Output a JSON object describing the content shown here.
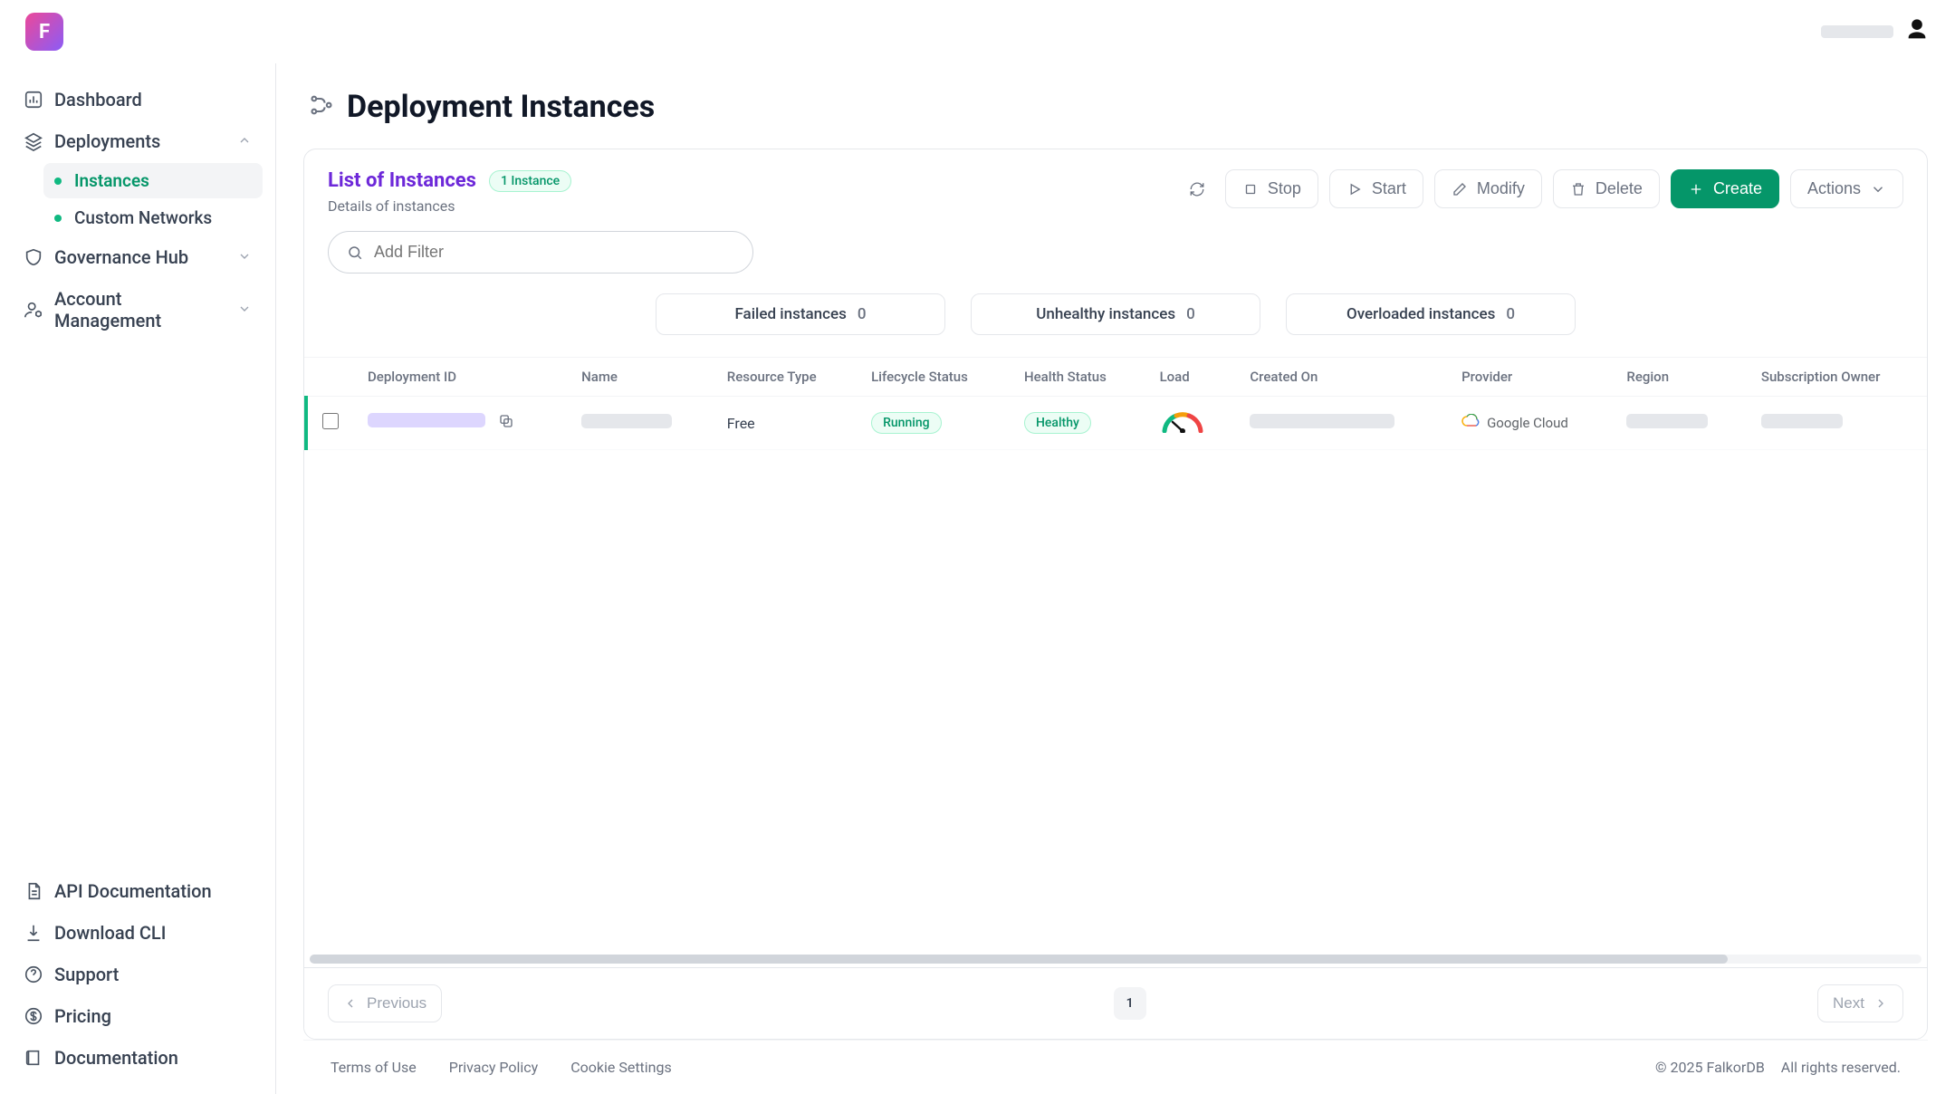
{
  "sidebar": {
    "items": [
      {
        "label": "Dashboard"
      },
      {
        "label": "Deployments"
      },
      {
        "label": "Governance Hub"
      },
      {
        "label": "Account Management"
      }
    ],
    "deployments_children": [
      {
        "label": "Instances"
      },
      {
        "label": "Custom Networks"
      }
    ],
    "footer_items": [
      {
        "label": "API Documentation"
      },
      {
        "label": "Download CLI"
      },
      {
        "label": "Support"
      },
      {
        "label": "Pricing"
      },
      {
        "label": "Documentation"
      }
    ]
  },
  "page": {
    "title": "Deployment Instances"
  },
  "list": {
    "title": "List of Instances",
    "count_label": "1 Instance",
    "subtitle": "Details of instances"
  },
  "toolbar": {
    "stop": "Stop",
    "start": "Start",
    "modify": "Modify",
    "delete": "Delete",
    "create": "Create",
    "actions": "Actions"
  },
  "filter": {
    "placeholder": "Add Filter"
  },
  "stats": [
    {
      "label": "Failed instances",
      "count": "0"
    },
    {
      "label": "Unhealthy instances",
      "count": "0"
    },
    {
      "label": "Overloaded instances",
      "count": "0"
    }
  ],
  "table": {
    "columns": [
      "Deployment ID",
      "Name",
      "Resource Type",
      "Lifecycle Status",
      "Health Status",
      "Load",
      "Created On",
      "Provider",
      "Region",
      "Subscription Owner"
    ],
    "rows": [
      {
        "resource_type": "Free",
        "lifecycle_status": "Running",
        "health_status": "Healthy",
        "provider": "Google Cloud"
      }
    ]
  },
  "pagination": {
    "previous": "Previous",
    "next": "Next",
    "current": "1"
  },
  "footer": {
    "left": [
      "Terms of Use",
      "Privacy Policy",
      "Cookie Settings"
    ],
    "copyright": "© 2025 FalkorDB",
    "rights": "All rights reserved."
  }
}
